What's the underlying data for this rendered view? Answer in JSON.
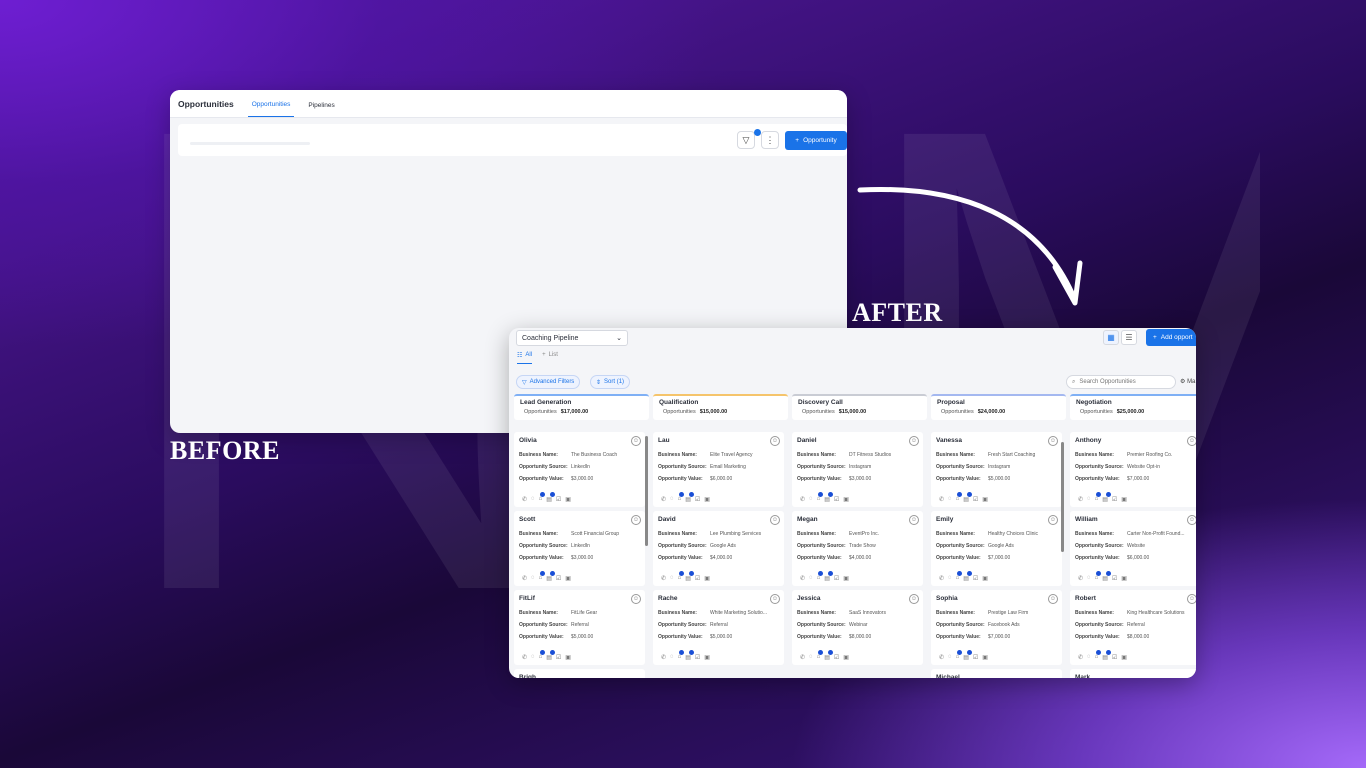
{
  "background_word": "NIMAD",
  "labels": {
    "before": "BEFORE",
    "after": "AFTER"
  },
  "colors": {
    "accent": "#1a73e8",
    "bg_dark": "#2a0c5e",
    "bg_light": "#a56cff"
  },
  "before": {
    "title": "Opportunities",
    "tabs": [
      {
        "label": "Opportunities",
        "active": true
      },
      {
        "label": "Pipelines",
        "active": false
      }
    ],
    "add_button": "Opportunity",
    "filter_icon": "filter-icon",
    "more_icon": "kebab-icon"
  },
  "after": {
    "pipeline_select": "Coaching Pipeline",
    "add_button": "Add opport",
    "view_tabs": [
      {
        "label": "All",
        "active": true
      },
      {
        "label": "List",
        "active": false
      }
    ],
    "advanced_filters": "Advanced Filters",
    "sort": "Sort (1)",
    "search_placeholder": "Search Opportunities",
    "manage": "Ma",
    "field_labels": {
      "business": "Business Name:",
      "source": "Opportunity Source:",
      "value": "Opportunity Value:"
    },
    "opportunities_label": "Opportunities",
    "columns": [
      {
        "name": "Lead Generation",
        "total": "$17,000.00",
        "cards": [
          {
            "name": "Olivia",
            "business": "The Business Coach",
            "source": "LinkedIn",
            "value": "$3,000.00"
          },
          {
            "name": "Scott",
            "business": "Scott Financial Group",
            "source": "LinkedIn",
            "value": "$3,000.00"
          },
          {
            "name": "FitLif",
            "business": "FitLife Gear",
            "source": "Referral",
            "value": "$5,000.00"
          }
        ],
        "next": "Brigh"
      },
      {
        "name": "Qualification",
        "total": "$15,000.00",
        "cards": [
          {
            "name": "Lau",
            "business": "Elite Travel Agency",
            "source": "Email Marketing",
            "value": "$6,000.00"
          },
          {
            "name": "David",
            "business": "Lee Plumbing Services",
            "source": "Google Ads",
            "value": "$4,000.00"
          },
          {
            "name": "Rache",
            "business": "White Marketing Solutio...",
            "source": "Referral",
            "value": "$5,000.00"
          }
        ],
        "next": ""
      },
      {
        "name": "Discovery Call",
        "total": "$15,000.00",
        "cards": [
          {
            "name": "Daniel",
            "business": "DT Fitness Studios",
            "source": "Instagram",
            "value": "$3,000.00"
          },
          {
            "name": "Megan",
            "business": "EventPro Inc.",
            "source": "Trade Show",
            "value": "$4,000.00"
          },
          {
            "name": "Jessica",
            "business": "SaaS Innovators",
            "source": "Webinar",
            "value": "$8,000.00"
          }
        ],
        "next": ""
      },
      {
        "name": "Proposal",
        "total": "$24,000.00",
        "cards": [
          {
            "name": "Vanessa",
            "business": "Fresh Start Coaching",
            "source": "Instagram",
            "value": "$5,000.00"
          },
          {
            "name": "Emily",
            "business": "Healthy Choices Clinic",
            "source": "Google Ads",
            "value": "$7,000.00"
          },
          {
            "name": "Sophia",
            "business": "Prestige Law Firm",
            "source": "Facebook Ads",
            "value": "$7,000.00"
          }
        ],
        "next": "Michael"
      },
      {
        "name": "Negotiation",
        "total": "$25,000.00",
        "cards": [
          {
            "name": "Anthony",
            "business": "Premier Roofing Co.",
            "source": "Website Opt-in",
            "value": "$7,000.00"
          },
          {
            "name": "William",
            "business": "Carter Non-Profit Found...",
            "source": "Website",
            "value": "$6,000.00"
          },
          {
            "name": "Robert",
            "business": "King Healthcare Solutions",
            "source": "Referral",
            "value": "$8,000.00"
          }
        ],
        "next": "Mark"
      }
    ]
  }
}
